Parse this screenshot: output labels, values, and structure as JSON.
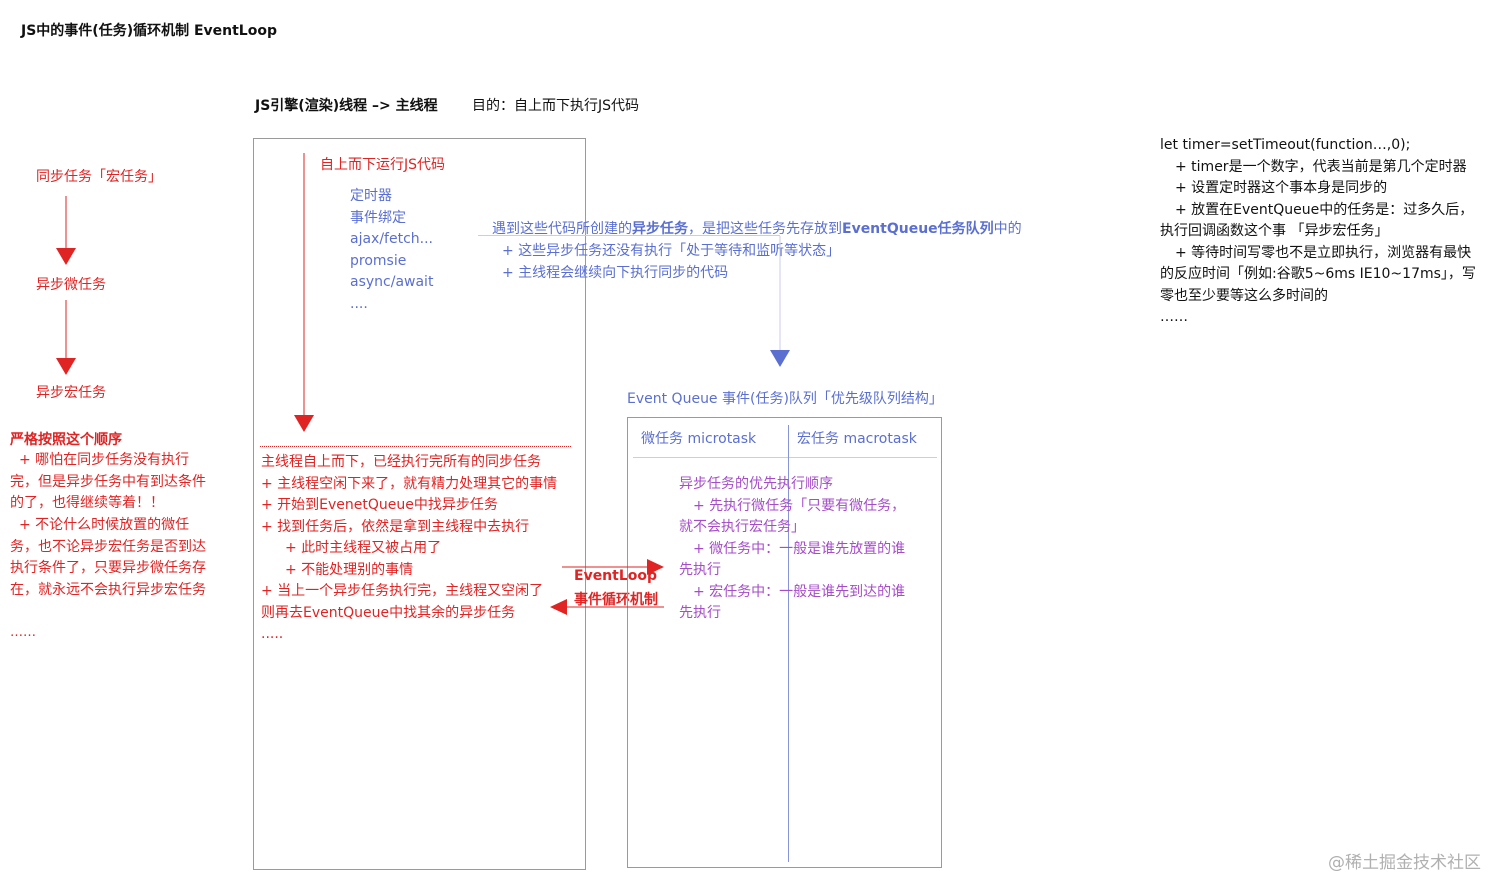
{
  "header": {
    "title": "JS中的事件(任务)循环机制 EventLoop",
    "thread_label": "JS引擎(渲染)线程 –> 主线程",
    "purpose": "目的：自上而下执行JS代码"
  },
  "left_order": {
    "step1": "同步任务「宏任务」",
    "step2": "异步微任务",
    "step3": "异步宏任务",
    "strict_title": "严格按照这个顺序",
    "strict_note1": "+ 哪怕在同步任务没有执行完，但是异步任务中有到达条件的了，也得继续等着！！",
    "strict_note2": "+ 不论什么时候放置的微任务，也不论异步宏任务是否到达执行条件了，只要异步微任务存在，就永远不会执行异步宏任务",
    "strict_ellipsis": "……"
  },
  "main_thread": {
    "run_label": "自上而下运行JS代码",
    "async_items": [
      "定时器",
      "事件绑定",
      "ajax/fetch...",
      "promsie",
      "async/await",
      "...."
    ],
    "lines": [
      "主线程自上而下，已经执行完所有的同步任务",
      "+ 主线程空闲下来了，就有精力处理其它的事情",
      "+ 开始到EvenetQueue中找异步任务",
      "+ 找到任务后，依然是拿到主线程中去执行",
      "+ 此时主线程又被占用了",
      "+ 不能处理别的事情",
      "+ 当上一个异步任务执行完，主线程又空闲了",
      "则再去EventQueue中找其余的异步任务",
      "....."
    ]
  },
  "async_note": {
    "line1_pre": "遇到这些代码所创建的",
    "line1_bold1": "异步任务",
    "line1_mid": "，是把这些任务先存放到",
    "line1_bold2": "EventQueue任务队列",
    "line1_post": "中的",
    "line2": "+ 这些异步任务还没有执行「处于等待和监听等状态」",
    "line3": "+ 主线程会继续向下执行同步的代码"
  },
  "event_loop": {
    "label1": "EventLoop",
    "label2": "事件循环机制"
  },
  "event_queue": {
    "title": "Event Queue 事件(任务)队列「优先级队列结构」",
    "micro_header": "微任务 microtask",
    "macro_header": "宏任务  macrotask",
    "priority_title": "异步任务的优先执行顺序",
    "priority_line1": "+ 先执行微任务「只要有微任务，",
    "priority_line2": "就不会执行宏任务」",
    "priority_line3": "+ 微任务中：一般是谁先放置的谁",
    "priority_line4": "先执行",
    "priority_line5": "+ 宏任务中：一般是谁先到达的谁",
    "priority_line6": "先执行"
  },
  "timer_note": {
    "code": "let timer=setTimeout(function…,0);",
    "line1": "+ timer是一个数字，代表当前是第几个定时器",
    "line2": "+ 设置定时器这个事本身是同步的",
    "line3": "+ 放置在EventQueue中的任务是：过多久后，",
    "line4": "执行回调函数这个事 「异步宏任务」",
    "line5": "+ 等待时间写零也不是立即执行，浏览器有最快",
    "line6": "的反应时间「例如:谷歌5~6ms IE10~17ms」，写",
    "line7": "零也至少要等这么多时间的",
    "line8": "……"
  },
  "watermark": "@稀土掘金技术社区",
  "colors": {
    "red": "#e02323",
    "blue": "#5b6fd0",
    "border": "#9a9a9a"
  }
}
